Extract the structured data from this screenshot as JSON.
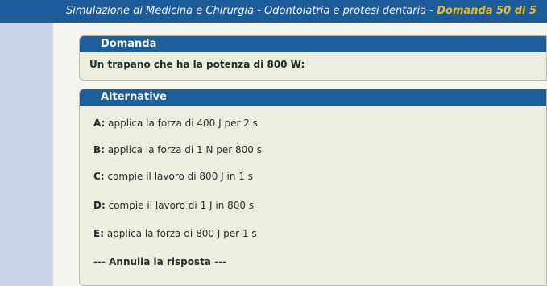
{
  "header": {
    "title": "Simulazione di Medicina e Chirurgia - Odontoiatria e protesi dentaria - ",
    "question_counter": "Domanda 50 di 5"
  },
  "question": {
    "section_label": "Domanda",
    "text": "Un trapano che ha la potenza di 800 W:"
  },
  "alternatives": {
    "section_label": "Alternative",
    "items": [
      {
        "letter": "A:",
        "text": "applica la forza di 400 J per 2 s"
      },
      {
        "letter": "B:",
        "text": "applica la forza di 1 N per 800 s"
      },
      {
        "letter": "C:",
        "text": "compie il lavoro di 800 J in 1 s"
      },
      {
        "letter": "D:",
        "text": "compie il lavoro di 1 J in 800 s"
      },
      {
        "letter": "E:",
        "text": "applica la forza di 800 J per 1 s"
      }
    ],
    "cancel_label": "--- Annulla la risposta ---"
  },
  "colors": {
    "header_blue": "#1d5f9d",
    "highlight_gold": "#e8b830",
    "panel_bg": "#ececdf"
  }
}
